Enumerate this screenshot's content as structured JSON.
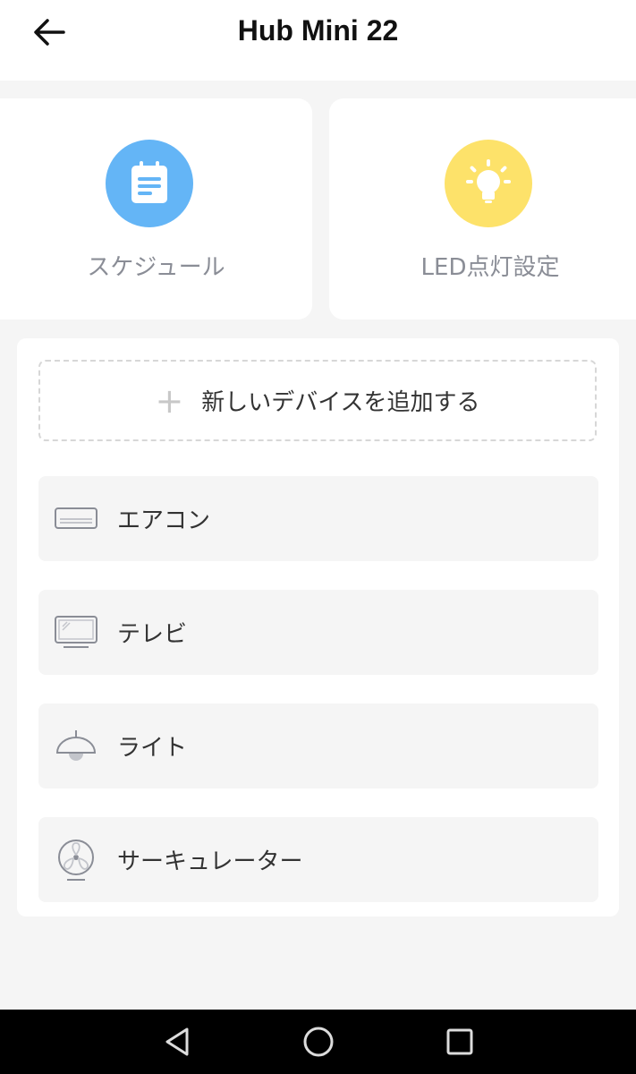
{
  "header": {
    "title": "Hub Mini 22",
    "back_icon": "arrow-left-icon"
  },
  "cards": {
    "schedule": {
      "label": "スケジュール",
      "icon": "calendar-icon",
      "color": "#64b5f6"
    },
    "led": {
      "label": "LED点灯設定",
      "icon": "lightbulb-icon",
      "color": "#fde26a"
    }
  },
  "device_panel": {
    "add_label": "新しいデバイスを追加する",
    "add_icon": "plus-icon",
    "devices": [
      {
        "label": "エアコン",
        "icon": "air-conditioner-icon"
      },
      {
        "label": "テレビ",
        "icon": "tv-icon"
      },
      {
        "label": "ライト",
        "icon": "ceiling-light-icon"
      },
      {
        "label": "サーキュレーター",
        "icon": "fan-icon"
      }
    ]
  },
  "nav_bar": {
    "back": "nav-back-icon",
    "home": "nav-home-icon",
    "recents": "nav-recents-icon"
  }
}
